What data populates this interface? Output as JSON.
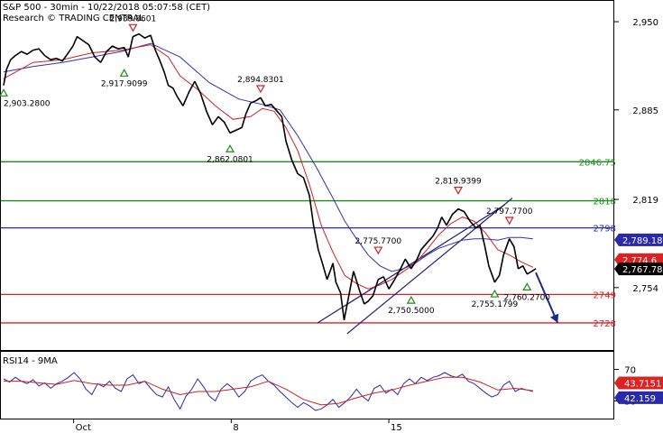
{
  "header": {
    "title": "S&P 500 - 30min - 10/22/2018 05:07:58 (CET)",
    "source": "Research © TRADING CENTRAL"
  },
  "chart_data": {
    "type": "line",
    "price_range": [
      2710,
      2962
    ],
    "price_ticks": [
      {
        "label": "2,950",
        "value": 2950
      },
      {
        "label": "2,885",
        "value": 2885
      },
      {
        "label": "2,819",
        "value": 2819
      },
      {
        "label": "2,754",
        "value": 2754
      }
    ],
    "x_range": [
      0,
      100
    ],
    "date_ticks": [
      {
        "label": "Oct",
        "t": 11.9
      },
      {
        "label": "8",
        "t": 38.7
      },
      {
        "label": "15",
        "t": 65.5
      }
    ],
    "price_series": [
      [
        0,
        2903
      ],
      [
        0.5,
        2915
      ],
      [
        1.2,
        2922
      ],
      [
        2,
        2925
      ],
      [
        3,
        2928
      ],
      [
        4,
        2926
      ],
      [
        5,
        2929
      ],
      [
        6,
        2930
      ],
      [
        7,
        2925
      ],
      [
        8,
        2922
      ],
      [
        9,
        2923
      ],
      [
        10,
        2921
      ],
      [
        11,
        2927
      ],
      [
        11.8,
        2932
      ],
      [
        12.5,
        2939
      ],
      [
        13.5,
        2936
      ],
      [
        14.5,
        2933
      ],
      [
        15.5,
        2924
      ],
      [
        16.5,
        2920
      ],
      [
        17.5,
        2928
      ],
      [
        18.5,
        2932
      ],
      [
        19.5,
        2930
      ],
      [
        20.5,
        2931
      ],
      [
        21.2,
        2924
      ],
      [
        22,
        2939
      ],
      [
        23,
        2941
      ],
      [
        24,
        2938
      ],
      [
        25,
        2940
      ],
      [
        25.8,
        2929
      ],
      [
        26.5,
        2922
      ],
      [
        27.3,
        2913
      ],
      [
        28,
        2903
      ],
      [
        28.8,
        2901
      ],
      [
        29.5,
        2895
      ],
      [
        30.5,
        2888
      ],
      [
        31.5,
        2898
      ],
      [
        32.5,
        2906
      ],
      [
        33.5,
        2897
      ],
      [
        34.5,
        2884
      ],
      [
        35.5,
        2874
      ],
      [
        36.5,
        2880
      ],
      [
        37.5,
        2876
      ],
      [
        38.5,
        2868
      ],
      [
        39.5,
        2870
      ],
      [
        40.5,
        2872
      ],
      [
        41.2,
        2882
      ],
      [
        42,
        2890
      ],
      [
        43,
        2892
      ],
      [
        43.7,
        2894
      ],
      [
        44.5,
        2888
      ],
      [
        45.5,
        2889
      ],
      [
        46.5,
        2884
      ],
      [
        47.3,
        2880
      ],
      [
        48,
        2862
      ],
      [
        49,
        2848
      ],
      [
        50,
        2838
      ],
      [
        51,
        2835
      ],
      [
        52,
        2822
      ],
      [
        52.7,
        2800
      ],
      [
        53.5,
        2782
      ],
      [
        54.2,
        2772
      ],
      [
        55,
        2760
      ],
      [
        56,
        2772
      ],
      [
        56.5,
        2758
      ],
      [
        57.3,
        2750
      ],
      [
        57.9,
        2730
      ],
      [
        58.7,
        2748
      ],
      [
        59.5,
        2766
      ],
      [
        60.5,
        2752
      ],
      [
        61.3,
        2742
      ],
      [
        62,
        2744
      ],
      [
        62.8,
        2748
      ],
      [
        63.7,
        2760
      ],
      [
        64.6,
        2762
      ],
      [
        65.5,
        2753
      ],
      [
        66.5,
        2760
      ],
      [
        67.5,
        2768
      ],
      [
        68.3,
        2775
      ],
      [
        69.3,
        2768
      ],
      [
        70.3,
        2775
      ],
      [
        71,
        2782
      ],
      [
        72,
        2787
      ],
      [
        73,
        2792
      ],
      [
        73.8,
        2798
      ],
      [
        74.5,
        2806
      ],
      [
        75.3,
        2800
      ],
      [
        76.3,
        2808
      ],
      [
        77.3,
        2812
      ],
      [
        78.3,
        2810
      ],
      [
        79.3,
        2803
      ],
      [
        80.3,
        2798
      ],
      [
        81,
        2800
      ],
      [
        81.8,
        2785
      ],
      [
        82.5,
        2770
      ],
      [
        83.5,
        2758
      ],
      [
        84.3,
        2763
      ],
      [
        85,
        2778
      ],
      [
        86,
        2790
      ],
      [
        86.8,
        2784
      ],
      [
        87.5,
        2768
      ],
      [
        88.3,
        2770
      ],
      [
        89,
        2764
      ],
      [
        89.8,
        2766
      ],
      [
        90.5,
        2768
      ]
    ],
    "ma_fast": [
      [
        0,
        2908
      ],
      [
        5,
        2920
      ],
      [
        10,
        2922
      ],
      [
        15,
        2927
      ],
      [
        20,
        2929
      ],
      [
        25,
        2933
      ],
      [
        28,
        2924
      ],
      [
        30,
        2910
      ],
      [
        33,
        2900
      ],
      [
        36,
        2888
      ],
      [
        39,
        2878
      ],
      [
        42,
        2880
      ],
      [
        44,
        2886
      ],
      [
        46,
        2884
      ],
      [
        48,
        2872
      ],
      [
        50,
        2855
      ],
      [
        52,
        2830
      ],
      [
        54,
        2800
      ],
      [
        56,
        2780
      ],
      [
        58,
        2763
      ],
      [
        60,
        2757
      ],
      [
        62,
        2753
      ],
      [
        64,
        2756
      ],
      [
        66,
        2760
      ],
      [
        68,
        2766
      ],
      [
        70,
        2772
      ],
      [
        72,
        2782
      ],
      [
        74,
        2793
      ],
      [
        76,
        2801
      ],
      [
        78,
        2806
      ],
      [
        80,
        2803
      ],
      [
        82,
        2794
      ],
      [
        84,
        2782
      ],
      [
        86,
        2778
      ],
      [
        88,
        2773
      ],
      [
        90,
        2769
      ]
    ],
    "ma_slow": [
      [
        0,
        2913
      ],
      [
        5,
        2917
      ],
      [
        10,
        2920
      ],
      [
        15,
        2924
      ],
      [
        20,
        2928
      ],
      [
        25,
        2934
      ],
      [
        30,
        2924
      ],
      [
        35,
        2905
      ],
      [
        40,
        2893
      ],
      [
        44,
        2889
      ],
      [
        47,
        2885
      ],
      [
        50,
        2866
      ],
      [
        53,
        2844
      ],
      [
        56,
        2820
      ],
      [
        58,
        2803
      ],
      [
        60,
        2790
      ],
      [
        62,
        2778
      ],
      [
        64,
        2770
      ],
      [
        66,
        2766
      ],
      [
        68,
        2768
      ],
      [
        70,
        2772
      ],
      [
        72,
        2778
      ],
      [
        74,
        2783
      ],
      [
        76,
        2786
      ],
      [
        78,
        2789
      ],
      [
        80,
        2790
      ],
      [
        82,
        2790
      ],
      [
        84,
        2789
      ],
      [
        86,
        2791
      ],
      [
        88,
        2791
      ],
      [
        90,
        2790
      ]
    ],
    "levels": [
      {
        "value": 2846.75,
        "label": "2846.75",
        "color": "#1a8c1a"
      },
      {
        "value": 2818,
        "label": "2818",
        "color": "#1a8c1a"
      },
      {
        "value": 2798,
        "label": "2798",
        "color": "#2a2aa8"
      },
      {
        "value": 2749,
        "label": "2749",
        "color": "#dd2222"
      },
      {
        "value": 2728,
        "label": "2728",
        "color": "#dd2222"
      }
    ],
    "price_tags": [
      {
        "label": "2,789.18",
        "value": 2789.18,
        "color": "#2a2aa8"
      },
      {
        "label": "2,774.6",
        "value": 2774.6,
        "color": "#dd2222"
      },
      {
        "label": "2,767.78",
        "value": 2767.78,
        "color": "#000000"
      }
    ],
    "swing_points": [
      {
        "label": "2,903.2800",
        "t": 0,
        "value": 2903.28,
        "kind": "low"
      },
      {
        "label": "2,917.9099",
        "t": 20.5,
        "value": 2917.91,
        "kind": "low"
      },
      {
        "label": "2,939.8601",
        "t": 22,
        "value": 2939.86,
        "kind": "high"
      },
      {
        "label": "2,894.8301",
        "t": 43.7,
        "value": 2894.83,
        "kind": "high"
      },
      {
        "label": "2,862.0801",
        "t": 38.5,
        "value": 2862.08,
        "kind": "low"
      },
      {
        "label": "2,775.7700",
        "t": 63.7,
        "value": 2775.77,
        "kind": "high"
      },
      {
        "label": "2,750.5000",
        "t": 69.3,
        "value": 2750.5,
        "kind": "low"
      },
      {
        "label": "2,819.9399",
        "t": 77.3,
        "value": 2819.94,
        "kind": "high"
      },
      {
        "label": "2,797.7700",
        "t": 86,
        "value": 2797.77,
        "kind": "high"
      },
      {
        "label": "2,755.1799",
        "t": 83.5,
        "value": 2755.18,
        "kind": "low"
      },
      {
        "label": "2,760.2700",
        "t": 89,
        "value": 2760.27,
        "kind": "low"
      }
    ],
    "channel": [
      {
        "t1": 53.4,
        "v1": 2728,
        "t2": 85.2,
        "v2": 2815
      },
      {
        "t1": 58.4,
        "v1": 2720,
        "t2": 86.5,
        "v2": 2820
      }
    ],
    "forecast_arrow": {
      "t1": 90.5,
      "v1": 2765,
      "t2": 94.2,
      "v2": 2728
    },
    "rsi": {
      "title": "RSI14 - 9MA",
      "range": [
        10,
        90
      ],
      "ticks": [
        {
          "label": "70",
          "value": 70
        },
        {
          "label": "30",
          "value": 30
        }
      ],
      "rsi": [
        [
          0,
          58
        ],
        [
          1,
          54
        ],
        [
          2,
          60
        ],
        [
          3,
          55
        ],
        [
          4,
          52
        ],
        [
          5,
          57
        ],
        [
          6,
          49
        ],
        [
          7,
          53
        ],
        [
          8,
          46
        ],
        [
          9,
          52
        ],
        [
          10,
          55
        ],
        [
          11,
          60
        ],
        [
          12,
          66
        ],
        [
          13,
          58
        ],
        [
          14,
          45
        ],
        [
          15,
          38
        ],
        [
          16,
          52
        ],
        [
          17,
          48
        ],
        [
          18,
          55
        ],
        [
          19,
          46
        ],
        [
          20,
          42
        ],
        [
          21,
          58
        ],
        [
          22,
          63
        ],
        [
          23,
          52
        ],
        [
          24,
          55
        ],
        [
          25,
          46
        ],
        [
          26,
          38
        ],
        [
          27,
          35
        ],
        [
          28,
          48
        ],
        [
          29,
          32
        ],
        [
          30,
          20
        ],
        [
          31,
          36
        ],
        [
          32,
          45
        ],
        [
          33,
          58
        ],
        [
          34,
          48
        ],
        [
          35,
          36
        ],
        [
          36,
          30
        ],
        [
          37,
          45
        ],
        [
          38,
          52
        ],
        [
          39,
          46
        ],
        [
          40,
          35
        ],
        [
          41,
          42
        ],
        [
          42,
          55
        ],
        [
          43,
          60
        ],
        [
          44,
          63
        ],
        [
          45,
          55
        ],
        [
          46,
          50
        ],
        [
          47,
          42
        ],
        [
          48,
          35
        ],
        [
          49,
          28
        ],
        [
          50,
          22
        ],
        [
          51,
          28
        ],
        [
          52,
          24
        ],
        [
          53,
          18
        ],
        [
          54,
          20
        ],
        [
          55,
          25
        ],
        [
          56,
          32
        ],
        [
          57,
          22
        ],
        [
          58,
          28
        ],
        [
          59,
          35
        ],
        [
          60,
          45
        ],
        [
          61,
          36
        ],
        [
          62,
          30
        ],
        [
          63,
          46
        ],
        [
          64,
          50
        ],
        [
          65,
          40
        ],
        [
          66,
          45
        ],
        [
          67,
          38
        ],
        [
          68,
          52
        ],
        [
          69,
          58
        ],
        [
          70,
          52
        ],
        [
          71,
          60
        ],
        [
          72,
          56
        ],
        [
          73,
          60
        ],
        [
          74,
          62
        ],
        [
          75,
          66
        ],
        [
          76,
          62
        ],
        [
          77,
          60
        ],
        [
          78,
          64
        ],
        [
          79,
          55
        ],
        [
          80,
          52
        ],
        [
          81,
          46
        ],
        [
          82,
          40
        ],
        [
          83,
          35
        ],
        [
          84,
          38
        ],
        [
          85,
          50
        ],
        [
          86,
          55
        ],
        [
          87,
          42
        ],
        [
          88,
          46
        ],
        [
          89,
          44
        ],
        [
          90,
          42
        ]
      ],
      "ma": [
        [
          0,
          55
        ],
        [
          3,
          55
        ],
        [
          6,
          53
        ],
        [
          9,
          51
        ],
        [
          12,
          56
        ],
        [
          15,
          52
        ],
        [
          18,
          50
        ],
        [
          21,
          50
        ],
        [
          24,
          55
        ],
        [
          27,
          45
        ],
        [
          30,
          38
        ],
        [
          33,
          42
        ],
        [
          36,
          42
        ],
        [
          39,
          45
        ],
        [
          42,
          48
        ],
        [
          45,
          55
        ],
        [
          48,
          45
        ],
        [
          51,
          32
        ],
        [
          54,
          25
        ],
        [
          57,
          27
        ],
        [
          60,
          34
        ],
        [
          63,
          40
        ],
        [
          66,
          44
        ],
        [
          69,
          50
        ],
        [
          72,
          55
        ],
        [
          75,
          60
        ],
        [
          78,
          60
        ],
        [
          81,
          54
        ],
        [
          84,
          44
        ],
        [
          87,
          46
        ],
        [
          90,
          43
        ]
      ],
      "tags": [
        {
          "label": "43.7151",
          "value": 43.7151,
          "color": "#dd2222"
        },
        {
          "label": "42.159",
          "value": 42.159,
          "color": "#2a2aa8"
        }
      ]
    }
  }
}
